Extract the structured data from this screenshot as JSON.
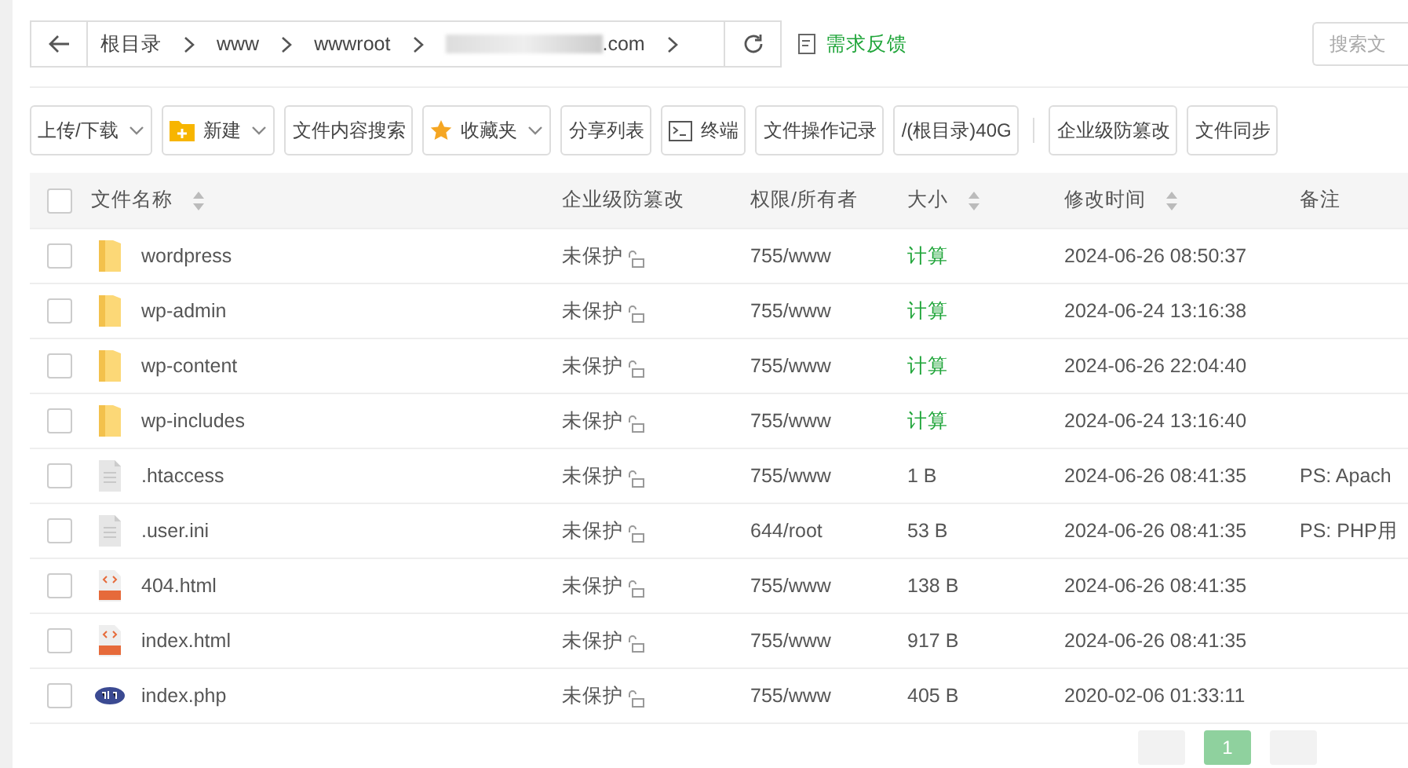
{
  "breadcrumb": {
    "segments": [
      "根目录",
      "www",
      "wwwroot",
      ".com"
    ]
  },
  "feedback": "需求反馈",
  "search": {
    "placeholder": "搜索文"
  },
  "toolbar_groups": [
    {
      "buttons": [
        {
          "label": "上传/下载",
          "kind": "plain",
          "dropdown": true
        },
        {
          "label": "新建",
          "kind": "folder",
          "dropdown": true
        },
        {
          "label": "文件内容搜索",
          "kind": "plain",
          "dropdown": false
        },
        {
          "label": "收藏夹",
          "kind": "star",
          "dropdown": true
        },
        {
          "label": "分享列表",
          "kind": "plain",
          "dropdown": false
        },
        {
          "label": "终端",
          "kind": "terminal",
          "dropdown": false
        },
        {
          "label": "文件操作记录",
          "kind": "plain",
          "dropdown": false
        },
        {
          "label": "/(根目录)40G",
          "kind": "plain",
          "dropdown": false
        }
      ]
    },
    {
      "buttons": [
        {
          "label": "企业级防篡改",
          "kind": "plain",
          "dropdown": false
        },
        {
          "label": "文件同步",
          "kind": "plain",
          "dropdown": false
        }
      ]
    }
  ],
  "table": {
    "all_checked": false,
    "columns": [
      {
        "label": "文件名称",
        "sortable": true
      },
      {
        "label": "企业级防篡改",
        "sortable": false
      },
      {
        "label": "权限/所有者",
        "sortable": false
      },
      {
        "label": "大小",
        "sortable": true
      },
      {
        "label": "修改时间",
        "sortable": true
      },
      {
        "label": "备注",
        "sortable": false
      }
    ],
    "rows": [
      {
        "kind": "folder",
        "name": "wordpress",
        "protection": "未保护",
        "perm": "755/www",
        "size": "计算",
        "modified": "2024-06-26 08:50:37",
        "checked": false
      },
      {
        "kind": "folder",
        "name": "wp-admin",
        "protection": "未保护",
        "perm": "755/www",
        "size": "计算",
        "modified": "2024-06-24 13:16:38",
        "checked": false
      },
      {
        "kind": "folder",
        "name": "wp-content",
        "protection": "未保护",
        "perm": "755/www",
        "size": "计算",
        "modified": "2024-06-26 22:04:40",
        "checked": false
      },
      {
        "kind": "folder",
        "name": "wp-includes",
        "protection": "未保护",
        "perm": "755/www",
        "size": "计算",
        "modified": "2024-06-24 13:16:40",
        "checked": false
      },
      {
        "kind": "text",
        "name": ".htaccess",
        "protection": "未保护",
        "perm": "755/www",
        "size": "1 B",
        "modified": "2024-06-26 08:41:35",
        "note": "PS: Apach",
        "checked": false
      },
      {
        "kind": "text",
        "name": ".user.ini",
        "protection": "未保护",
        "perm": "644/root",
        "size": "53 B",
        "modified": "2024-06-26 08:41:35",
        "note": "PS: PHP用",
        "checked": false
      },
      {
        "kind": "html",
        "name": "404.html",
        "protection": "未保护",
        "perm": "755/www",
        "size": "138 B",
        "modified": "2024-06-26 08:41:35",
        "checked": false
      },
      {
        "kind": "html",
        "name": "index.html",
        "protection": "未保护",
        "perm": "755/www",
        "size": "917 B",
        "modified": "2024-06-26 08:41:35",
        "checked": false
      },
      {
        "kind": "php",
        "name": "index.php",
        "protection": "未保护",
        "perm": "755/www",
        "size": "405 B",
        "modified": "2020-02-06 01:33:11",
        "checked": false
      }
    ]
  },
  "pagination": {
    "pages": [
      {
        "label": "1",
        "selected": true
      }
    ]
  }
}
